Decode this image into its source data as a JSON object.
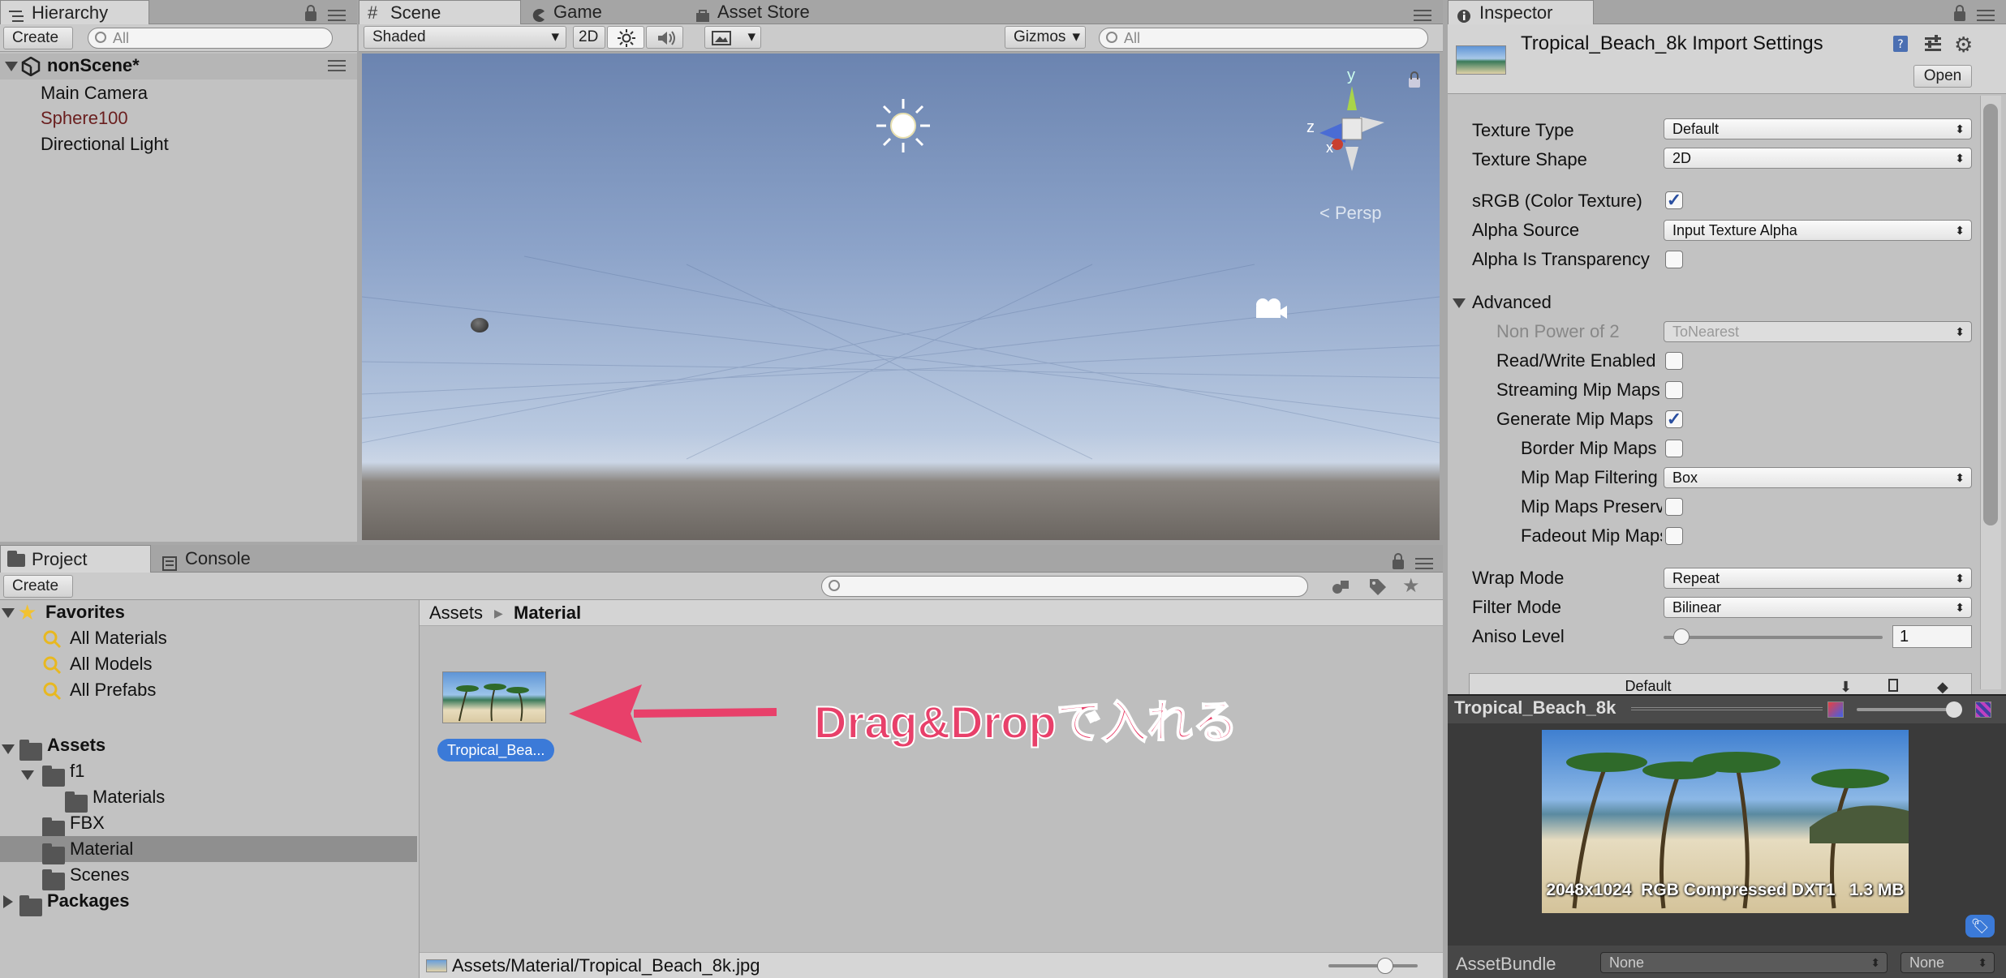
{
  "hierarchy": {
    "tab": "Hierarchy",
    "create": "Create",
    "search_placeholder": "All",
    "scene_name": "nonScene*",
    "items": [
      "Main Camera",
      "Sphere100",
      "Directional Light"
    ]
  },
  "scene": {
    "tabs": [
      "Scene",
      "Game",
      "Asset Store"
    ],
    "shading": "Shaded",
    "mode_2d": "2D",
    "gizmos": "Gizmos",
    "search_placeholder": "All",
    "persp": "Persp",
    "axis_y": "y",
    "axis_z": "z",
    "axis_x": "x"
  },
  "project": {
    "tabs": [
      "Project",
      "Console"
    ],
    "create": "Create",
    "favorites_label": "Favorites",
    "favorites": [
      "All Materials",
      "All Models",
      "All Prefabs"
    ],
    "assets_label": "Assets",
    "f1": "f1",
    "f1_children": [
      "Materials"
    ],
    "folders": [
      "FBX",
      "Material",
      "Scenes"
    ],
    "packages_label": "Packages",
    "breadcrumb": [
      "Assets",
      "Material"
    ],
    "asset_label": "Tropical_Bea...",
    "status_path": "Assets/Material/Tropical_Beach_8k.jpg",
    "annotation": "Drag&Dropで入れる"
  },
  "inspector": {
    "tab": "Inspector",
    "title": "Tropical_Beach_8k Import Settings",
    "open_button": "Open",
    "props": {
      "texture_type_label": "Texture Type",
      "texture_type": "Default",
      "texture_shape_label": "Texture Shape",
      "texture_shape": "2D",
      "srgb_label": "sRGB (Color Texture)",
      "alpha_source_label": "Alpha Source",
      "alpha_source": "Input Texture Alpha",
      "alpha_transparency_label": "Alpha Is Transparency",
      "advanced_label": "Advanced",
      "non_power_label": "Non Power of 2",
      "non_power": "ToNearest",
      "read_write_label": "Read/Write Enabled",
      "streaming_label": "Streaming Mip Maps",
      "generate_mip_label": "Generate Mip Maps",
      "border_mip_label": "Border Mip Maps",
      "mip_filtering_label": "Mip Map Filtering",
      "mip_filtering": "Box",
      "mip_preserve_label": "Mip Maps Preserve Coverage",
      "fadeout_label": "Fadeout Mip Maps",
      "wrap_label": "Wrap Mode",
      "wrap": "Repeat",
      "filter_label": "Filter Mode",
      "filter": "Bilinear",
      "aniso_label": "Aniso Level",
      "aniso": "1",
      "platform_default": "Default"
    },
    "preview": {
      "name": "Tropical_Beach_8k",
      "info": "2048x1024  RGB Compressed DXT1   1.3 MB",
      "assetbundle_label": "AssetBundle",
      "assetbundle": "None",
      "variant": "None"
    }
  },
  "checkbox_states": {
    "srgb": true,
    "alpha_transparency": false,
    "read_write": false,
    "streaming": false,
    "generate_mip": true,
    "border_mip": false,
    "mip_preserve": false,
    "fadeout": false
  },
  "icons": [
    "lock-icon",
    "menu-icon",
    "sun-icon",
    "audio-icon",
    "image-icon",
    "gear-icon",
    "folder-icon",
    "star-icon",
    "search-icon",
    "tag-icon"
  ],
  "colors": {
    "selection": "#3b7ad8",
    "annotation": "#e8406a",
    "sky_top": "#6b84b0",
    "sky_bottom": "#c4d2e6",
    "ground": "#6b6661"
  }
}
